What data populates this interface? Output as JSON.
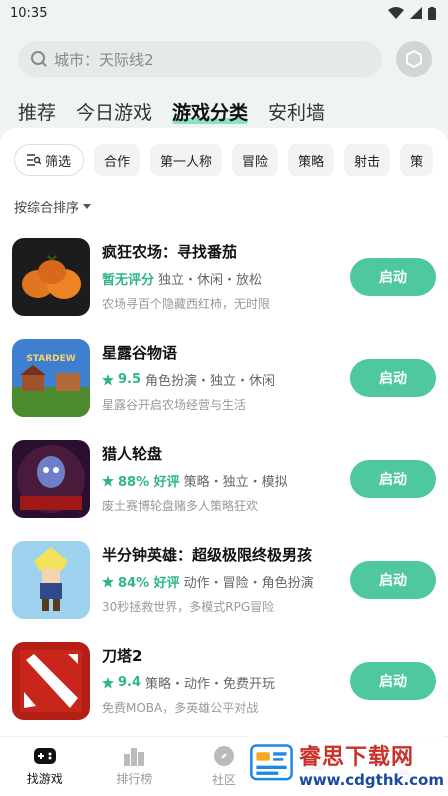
{
  "status": {
    "time": "10:35"
  },
  "search": {
    "placeholder": "城市：天际线2"
  },
  "tabs": [
    {
      "label": "推荐"
    },
    {
      "label": "今日游戏"
    },
    {
      "label": "游戏分类",
      "active": true
    },
    {
      "label": "安利墙"
    }
  ],
  "filters": {
    "filter_label": "筛选",
    "tags": [
      "合作",
      "第一人称",
      "冒险",
      "策略",
      "射击",
      "策"
    ]
  },
  "sort": {
    "label": "按综合排序"
  },
  "games": [
    {
      "name": "疯狂农场：寻找番茄",
      "score": "暂无评分",
      "tags": "独立・休闲・放松",
      "desc": "农场寻百个隐藏西红柿，无时限",
      "button": "启动",
      "has_star": false
    },
    {
      "name": "星露谷物语",
      "score": "9.5",
      "tags": "角色扮演・独立・休闲",
      "desc": "星露谷开启农场经营与生活",
      "button": "启动",
      "has_star": true
    },
    {
      "name": "猎人轮盘",
      "score": "88% 好评",
      "tags": "策略・独立・模拟",
      "desc": "废土赛博轮盘赌多人策略狂欢",
      "button": "启动",
      "has_star": true
    },
    {
      "name": "半分钟英雄：超级极限终极男孩",
      "score": "84% 好评",
      "tags": "动作・冒险・角色扮演",
      "desc": "30秒拯救世界，多模式RPG冒险",
      "button": "启动",
      "has_star": true
    },
    {
      "name": "刀塔2",
      "score": "9.4",
      "tags": "策略・动作・免费开玩",
      "desc": "免费MOBA，多英雄公平对战",
      "button": "启动",
      "has_star": true
    }
  ],
  "nav": [
    {
      "label": "找游戏",
      "icon": "gamepad-icon",
      "active": true
    },
    {
      "label": "排行榜",
      "icon": "ranking-icon"
    },
    {
      "label": "社区",
      "icon": "compass-icon"
    },
    {
      "label": "",
      "icon": "chat-icon"
    },
    {
      "label": "",
      "icon": "user-icon"
    }
  ],
  "watermark": {
    "title": "睿思下载网",
    "url": "www.cdgthk.com"
  },
  "colors": {
    "accent": "#4fc89d",
    "score": "#2fb685",
    "background": "#eef3f3"
  }
}
